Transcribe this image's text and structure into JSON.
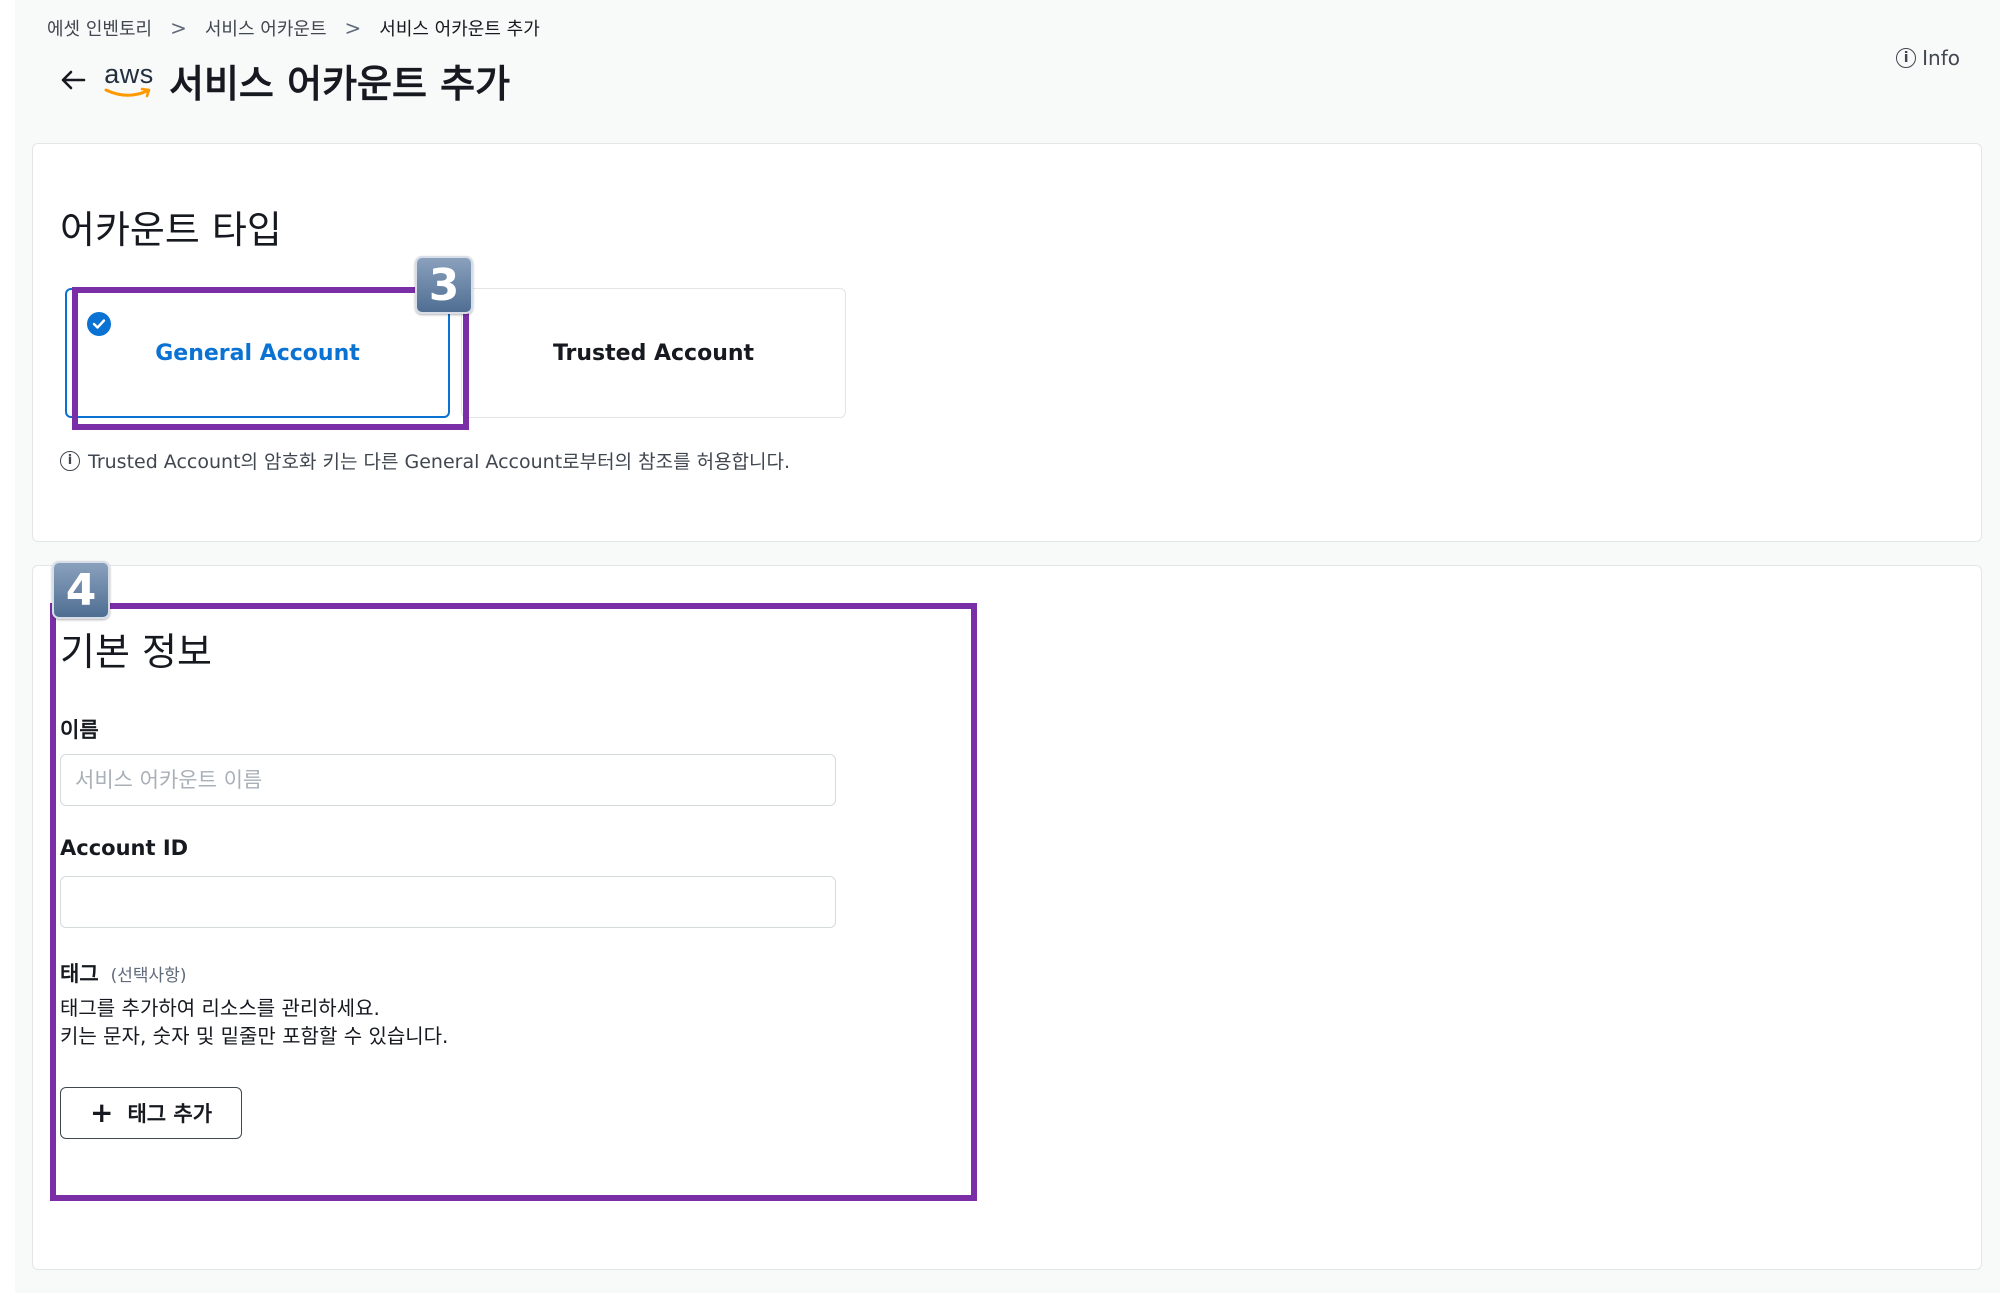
{
  "breadcrumb": {
    "items": [
      "에셋 인벤토리",
      "서비스 어카운트",
      "서비스 어카운트 추가"
    ],
    "separator": ">"
  },
  "header": {
    "logo_text": "aws",
    "title": "서비스 어카운트 추가",
    "info_label": "Info"
  },
  "account_type": {
    "title": "어카운트 타입",
    "options": [
      {
        "label": "General Account",
        "selected": true
      },
      {
        "label": "Trusted Account",
        "selected": false
      }
    ],
    "hint": "Trusted Account의 암호화 키는 다른 General Account로부터의 참조를 허용합니다."
  },
  "basic_info": {
    "title": "기본 정보",
    "name_label": "이름",
    "name_placeholder": "서비스 어카운트 이름",
    "name_value": "",
    "account_id_label": "Account ID",
    "account_id_value": "",
    "tag_label": "태그",
    "tag_optional": "(선택사항)",
    "tag_desc_line1": "태그를 추가하여 리소스를 관리하세요.",
    "tag_desc_line2": "키는 문자, 숫자 및 밑줄만 포함할 수 있습니다.",
    "add_tag_label": "태그 추가"
  },
  "annotations": {
    "badge_3": "3",
    "badge_4": "4"
  },
  "colors": {
    "primary": "#0972d3",
    "highlight": "#7b2fa7",
    "aws_smile": "#ff9900"
  }
}
